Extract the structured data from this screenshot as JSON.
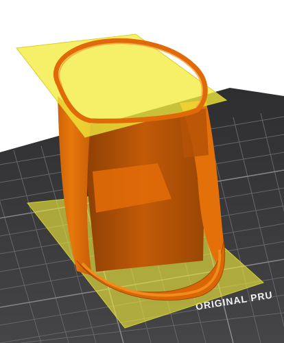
{
  "viewport": {
    "background": "#ffffff",
    "bed_color": "#3a3a3c",
    "grid_color": "#6e6e72",
    "model_color": "#e8740a",
    "model_shadow_color": "#b45306",
    "plane_color": "#f2ec3c",
    "bed_label": "ORIGINAL PRU"
  }
}
